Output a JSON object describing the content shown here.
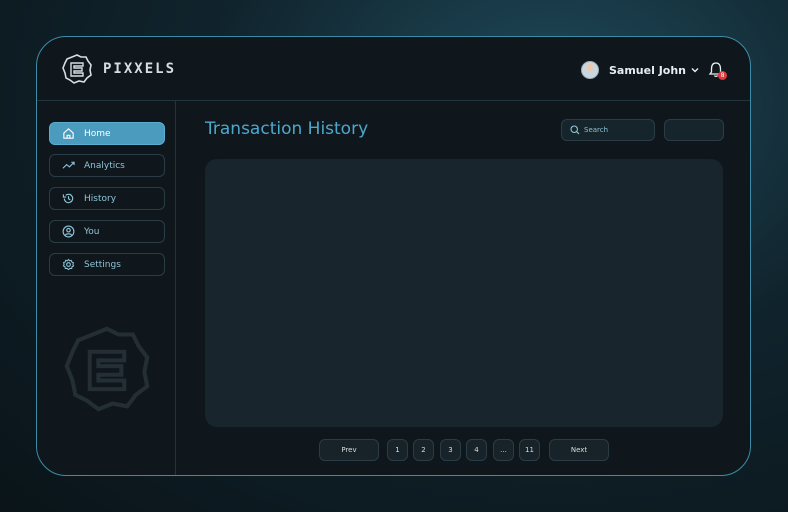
{
  "app": {
    "brand": "PIXXELS"
  },
  "user": {
    "name": "Samuel John",
    "notification_count": "8"
  },
  "sidebar": {
    "items": [
      {
        "label": "Home",
        "icon": "home-icon",
        "active": true
      },
      {
        "label": "Analytics",
        "icon": "trend-icon",
        "active": false
      },
      {
        "label": "History",
        "icon": "history-icon",
        "active": false
      },
      {
        "label": "You",
        "icon": "user-icon",
        "active": false
      },
      {
        "label": "Settings",
        "icon": "gear-icon",
        "active": false
      }
    ]
  },
  "main": {
    "title": "Transaction History",
    "search": {
      "placeholder": "Search",
      "value": ""
    }
  },
  "pagination": {
    "prev": "Prev",
    "pages": [
      "1",
      "2",
      "3",
      "4",
      "...",
      "11"
    ],
    "next": "Next"
  },
  "colors": {
    "accent": "#4ea8cc",
    "active_nav": "#4a9bbd",
    "border": "#3c8ca6",
    "badge": "#e0393e"
  }
}
